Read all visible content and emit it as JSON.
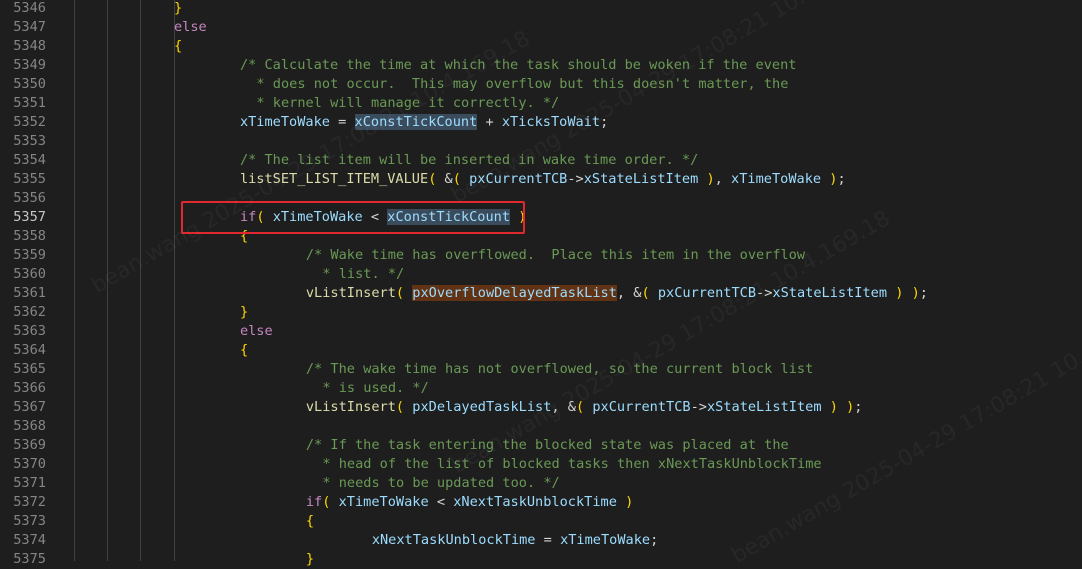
{
  "lines": [
    {
      "n": "5346",
      "t": "            }"
    },
    {
      "n": "5347",
      "t": "            else"
    },
    {
      "n": "5348",
      "t": "            {"
    },
    {
      "n": "5349",
      "t": "                /* Calculate the time at which the task should be woken if the event"
    },
    {
      "n": "5350",
      "t": "                 * does not occur.  This may overflow but this doesn't matter, the"
    },
    {
      "n": "5351",
      "t": "                 * kernel will manage it correctly. */"
    },
    {
      "n": "5352",
      "t": "                xTimeToWake = xConstTickCount + xTicksToWait;"
    },
    {
      "n": "5353",
      "t": ""
    },
    {
      "n": "5354",
      "t": "                /* The list item will be inserted in wake time order. */"
    },
    {
      "n": "5355",
      "t": "                listSET_LIST_ITEM_VALUE( &( pxCurrentTCB->xStateListItem ), xTimeToWake );"
    },
    {
      "n": "5356",
      "t": ""
    },
    {
      "n": "5357",
      "t": "                if( xTimeToWake < xConstTickCount )"
    },
    {
      "n": "5358",
      "t": "                {"
    },
    {
      "n": "5359",
      "t": "                    /* Wake time has overflowed.  Place this item in the overflow"
    },
    {
      "n": "5360",
      "t": "                     * list. */"
    },
    {
      "n": "5361",
      "t": "                    vListInsert( pxOverflowDelayedTaskList, &( pxCurrentTCB->xStateListItem ) );"
    },
    {
      "n": "5362",
      "t": "                }"
    },
    {
      "n": "5363",
      "t": "                else"
    },
    {
      "n": "5364",
      "t": "                {"
    },
    {
      "n": "5365",
      "t": "                    /* The wake time has not overflowed, so the current block list"
    },
    {
      "n": "5366",
      "t": "                     * is used. */"
    },
    {
      "n": "5367",
      "t": "                    vListInsert( pxDelayedTaskList, &( pxCurrentTCB->xStateListItem ) );"
    },
    {
      "n": "5368",
      "t": ""
    },
    {
      "n": "5369",
      "t": "                    /* If the task entering the blocked state was placed at the"
    },
    {
      "n": "5370",
      "t": "                     * head of the list of blocked tasks then xNextTaskUnblockTime"
    },
    {
      "n": "5371",
      "t": "                     * needs to be updated too. */"
    },
    {
      "n": "5372",
      "t": "                    if( xTimeToWake < xNextTaskUnblockTime )"
    },
    {
      "n": "5373",
      "t": "                    {"
    },
    {
      "n": "5374",
      "t": "                        xNextTaskUnblockTime = xTimeToWake;"
    },
    {
      "n": "5375",
      "t": "                    }"
    }
  ],
  "watermarks": [
    "bean.wang 2025-04-29 17:08:21 10.4.169.18",
    "bean.wang 2025-04-29 17:08:21 10.4.169.18",
    "bean.wang 2025-04-29 17:08:21 10.4.169.18",
    "bean.wang 2025-04-29 17:08:21 10.4.169.18"
  ],
  "colors": {
    "background": "#1e1e1e",
    "highlight_box": "#e0282d",
    "comment": "#6a9955",
    "keyword": "#c586c0",
    "identifier": "#9cdcfe",
    "function": "#dcdcaa"
  }
}
